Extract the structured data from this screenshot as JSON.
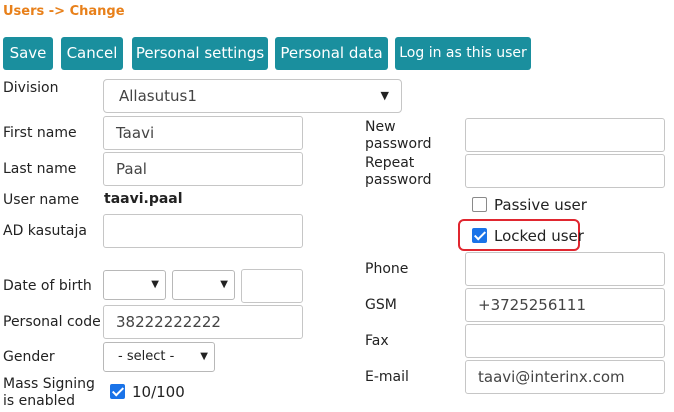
{
  "colors": {
    "accent": "#1a8f9e",
    "breadcrumb": "#e8801a",
    "highlight": "#e0262f",
    "checkbox": "#1a73e8"
  },
  "breadcrumb": "Users -> Change",
  "toolbar": {
    "save": "Save",
    "cancel": "Cancel",
    "personal_settings": "Personal settings",
    "personal_data": "Personal data",
    "log_in_as": "Log in as this user"
  },
  "form": {
    "division": {
      "label": "Division",
      "value": "Allasutus1"
    },
    "first_name": {
      "label": "First name",
      "value": "Taavi"
    },
    "last_name": {
      "label": "Last name",
      "value": "Paal"
    },
    "user_name": {
      "label": "User name",
      "value": "taavi.paal"
    },
    "ad_user": {
      "label": "AD kasutaja",
      "value": ""
    },
    "date_of_birth": {
      "label": "Date of birth",
      "day": "",
      "month": "",
      "year": ""
    },
    "personal_code": {
      "label": "Personal code",
      "value": "38222222222"
    },
    "gender": {
      "label": "Gender",
      "value": "- select -"
    },
    "mass_signing": {
      "label_line1": "Mass Signing",
      "label_line2": "is enabled",
      "checked": true,
      "value": "10/100"
    },
    "new_password": {
      "label_line1": "New",
      "label_line2": "password",
      "value": ""
    },
    "repeat_password": {
      "label_line1": "Repeat",
      "label_line2": "password",
      "value": ""
    },
    "passive_user": {
      "label": "Passive user",
      "checked": false
    },
    "locked_user": {
      "label": "Locked user",
      "checked": true
    },
    "phone": {
      "label": "Phone",
      "value": ""
    },
    "gsm": {
      "label": "GSM",
      "value": "+3725256111"
    },
    "fax": {
      "label": "Fax",
      "value": ""
    },
    "email": {
      "label": "E-mail",
      "value": "taavi@interinx.com"
    }
  }
}
